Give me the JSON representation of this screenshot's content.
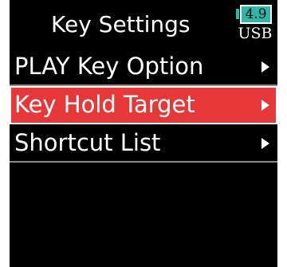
{
  "header": {
    "title": "Key Settings"
  },
  "status": {
    "battery_value": "4.9",
    "power_source": "USB"
  },
  "menu": {
    "items": [
      {
        "label": "PLAY Key Option",
        "selected": false
      },
      {
        "label": "Key Hold Target",
        "selected": true
      },
      {
        "label": "Shortcut List",
        "selected": false
      }
    ]
  },
  "icons": {
    "item_arrow": "chevron-right-icon",
    "battery": "battery-icon"
  },
  "colors": {
    "background": "#000000",
    "selection": "#e63838",
    "battery": "#2bb8a8",
    "text": "#ffffff"
  }
}
